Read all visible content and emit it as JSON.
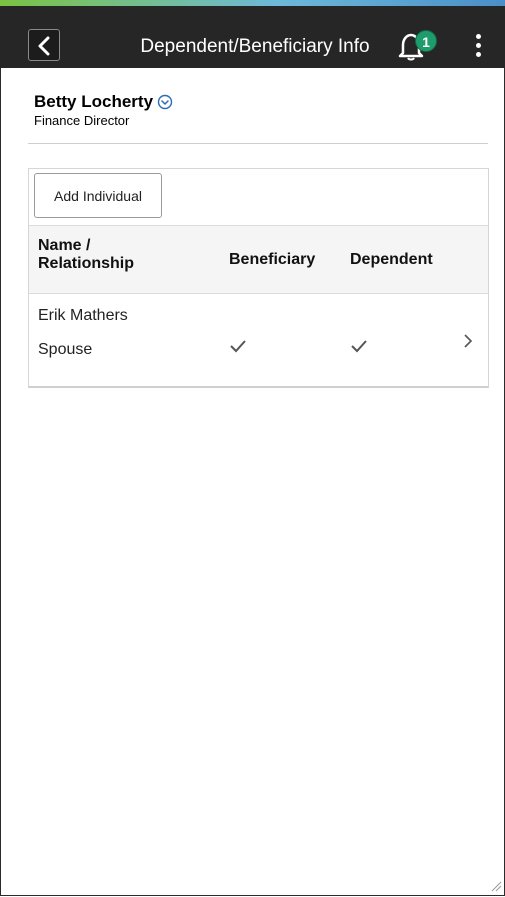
{
  "header": {
    "title": "Dependent/Beneficiary Info",
    "notification_count": "1",
    "accent_color": "#1f9c6b"
  },
  "person": {
    "name": "Betty Locherty",
    "job_title": "Finance Director"
  },
  "grid": {
    "add_button_label": "Add Individual",
    "columns": {
      "name_line1": "Name /",
      "name_line2": "Relationship",
      "beneficiary": "Beneficiary",
      "dependent": "Dependent"
    },
    "rows": [
      {
        "name": "Erik Mathers",
        "relationship": "Spouse",
        "beneficiary": true,
        "dependent": true
      }
    ]
  },
  "icons": [
    "back-icon",
    "bell-icon",
    "kebab-menu-icon",
    "chevron-down-circle-icon",
    "checkmark-icon",
    "chevron-right-icon",
    "resize-handle-icon"
  ]
}
